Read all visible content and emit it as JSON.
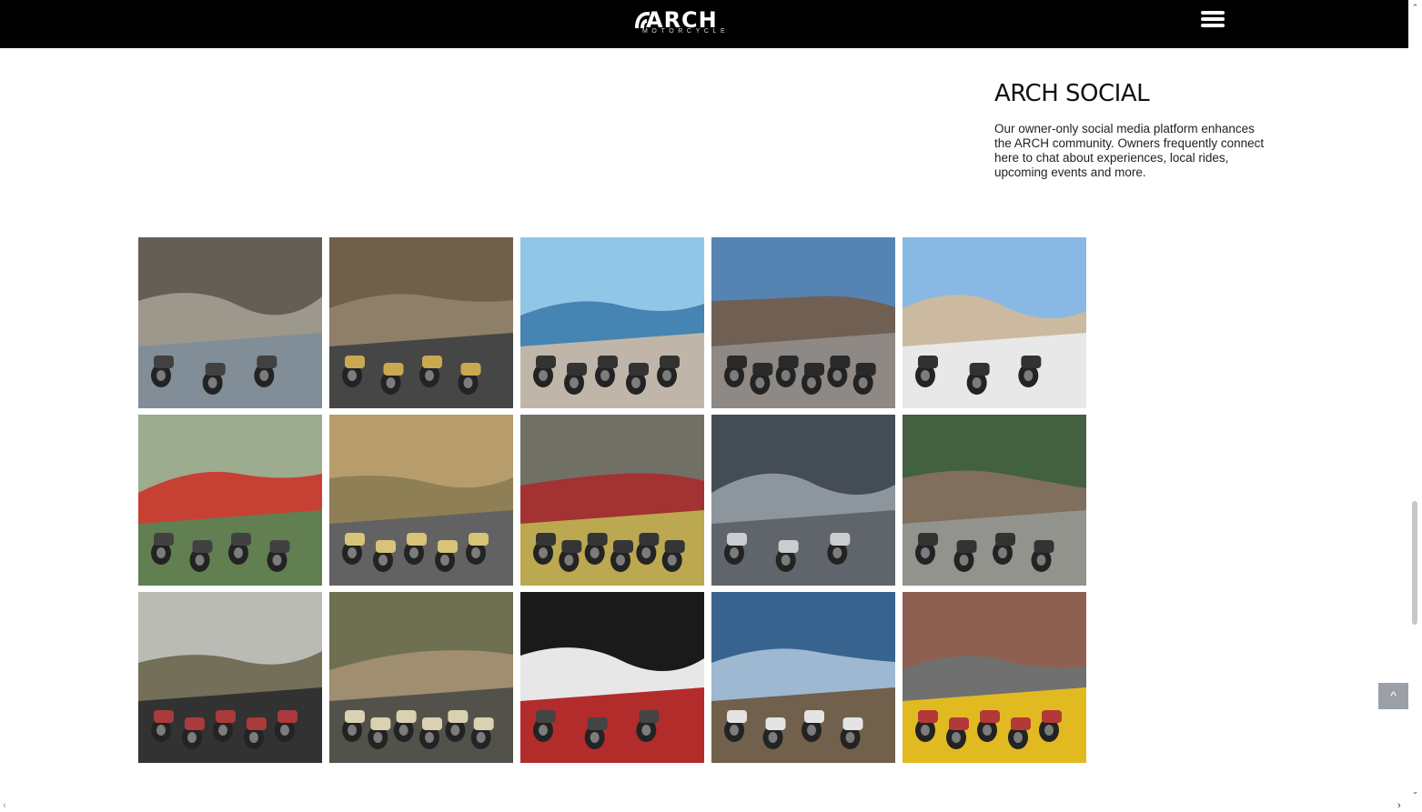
{
  "header": {
    "logo_text": "ARCH",
    "logo_subtext": "MOTORCYCLE",
    "menu_icon": "hamburger-menu-icon"
  },
  "social": {
    "title": "ARCH SOCIAL",
    "body": "Our owner-only social media platform enhances the ARCH community. Owners frequently connect here to chat about experiences, local rides, upcoming events and more."
  },
  "gallery": {
    "photos": [
      {
        "scene": "group-stone-building",
        "colors": [
          "#5e5850",
          "#9a9488",
          "#7c8a94",
          "#3a3a3a"
        ]
      },
      {
        "scene": "rider-canyon-road",
        "colors": [
          "#6b5a44",
          "#8a7a62",
          "#3f3f3f",
          "#c7a54a"
        ]
      },
      {
        "scene": "rider-coast-highway",
        "colors": [
          "#8ec4e6",
          "#3e7fb0",
          "#bdb3a6",
          "#2b2b2b"
        ]
      },
      {
        "scene": "bikes-rock-store",
        "colors": [
          "#4f7fb0",
          "#6b5a4c",
          "#8a8580",
          "#222222"
        ]
      },
      {
        "scene": "bikes-airplane",
        "colors": [
          "#86b6e4",
          "#c9b89c",
          "#e8e8e8",
          "#2a2a2a"
        ]
      },
      {
        "scene": "bikes-flowers",
        "colors": [
          "#9aa88a",
          "#c43a2c",
          "#5b7a4a",
          "#3a3a3a"
        ]
      },
      {
        "scene": "rider-country-road",
        "colors": [
          "#b59a66",
          "#8a7a50",
          "#5c5c5c",
          "#d6c272"
        ]
      },
      {
        "scene": "red-bike-lineup",
        "colors": [
          "#6b6b5e",
          "#a02a2a",
          "#b9a54a",
          "#2d2d2d"
        ]
      },
      {
        "scene": "bikes-warehouse",
        "colors": [
          "#3d4650",
          "#8a929a",
          "#5a5f66",
          "#c8ccd0"
        ]
      },
      {
        "scene": "stone-barn-bikes",
        "colors": [
          "#3c5a3a",
          "#7a6a56",
          "#8f8f8a",
          "#2b2b2b"
        ]
      },
      {
        "scene": "man-with-bikes",
        "colors": [
          "#b8b9b2",
          "#6f6a52",
          "#2a2a2a",
          "#a83232"
        ]
      },
      {
        "scene": "group-saloon",
        "colors": [
          "#6a6a4a",
          "#9c8a6a",
          "#4b4b44",
          "#d9d0b0"
        ]
      },
      {
        "scene": "red-bike-van",
        "colors": [
          "#111111",
          "#e6e6e6",
          "#b02424",
          "#3d3d3d"
        ]
      },
      {
        "scene": "couple-ocean-view",
        "colors": [
          "#2f5d8a",
          "#9ab6cf",
          "#6c5a44",
          "#e3e3e3"
        ]
      },
      {
        "scene": "rider-curve-sign",
        "colors": [
          "#8a5a4a",
          "#6b6b6b",
          "#e0b81a",
          "#b03030"
        ]
      }
    ]
  },
  "controls": {
    "scroll_top_label": "^",
    "scroll_up_glyph": "⌃",
    "scroll_down_glyph": "⌄",
    "scroll_left_glyph": "‹",
    "scroll_right_glyph": "›"
  }
}
